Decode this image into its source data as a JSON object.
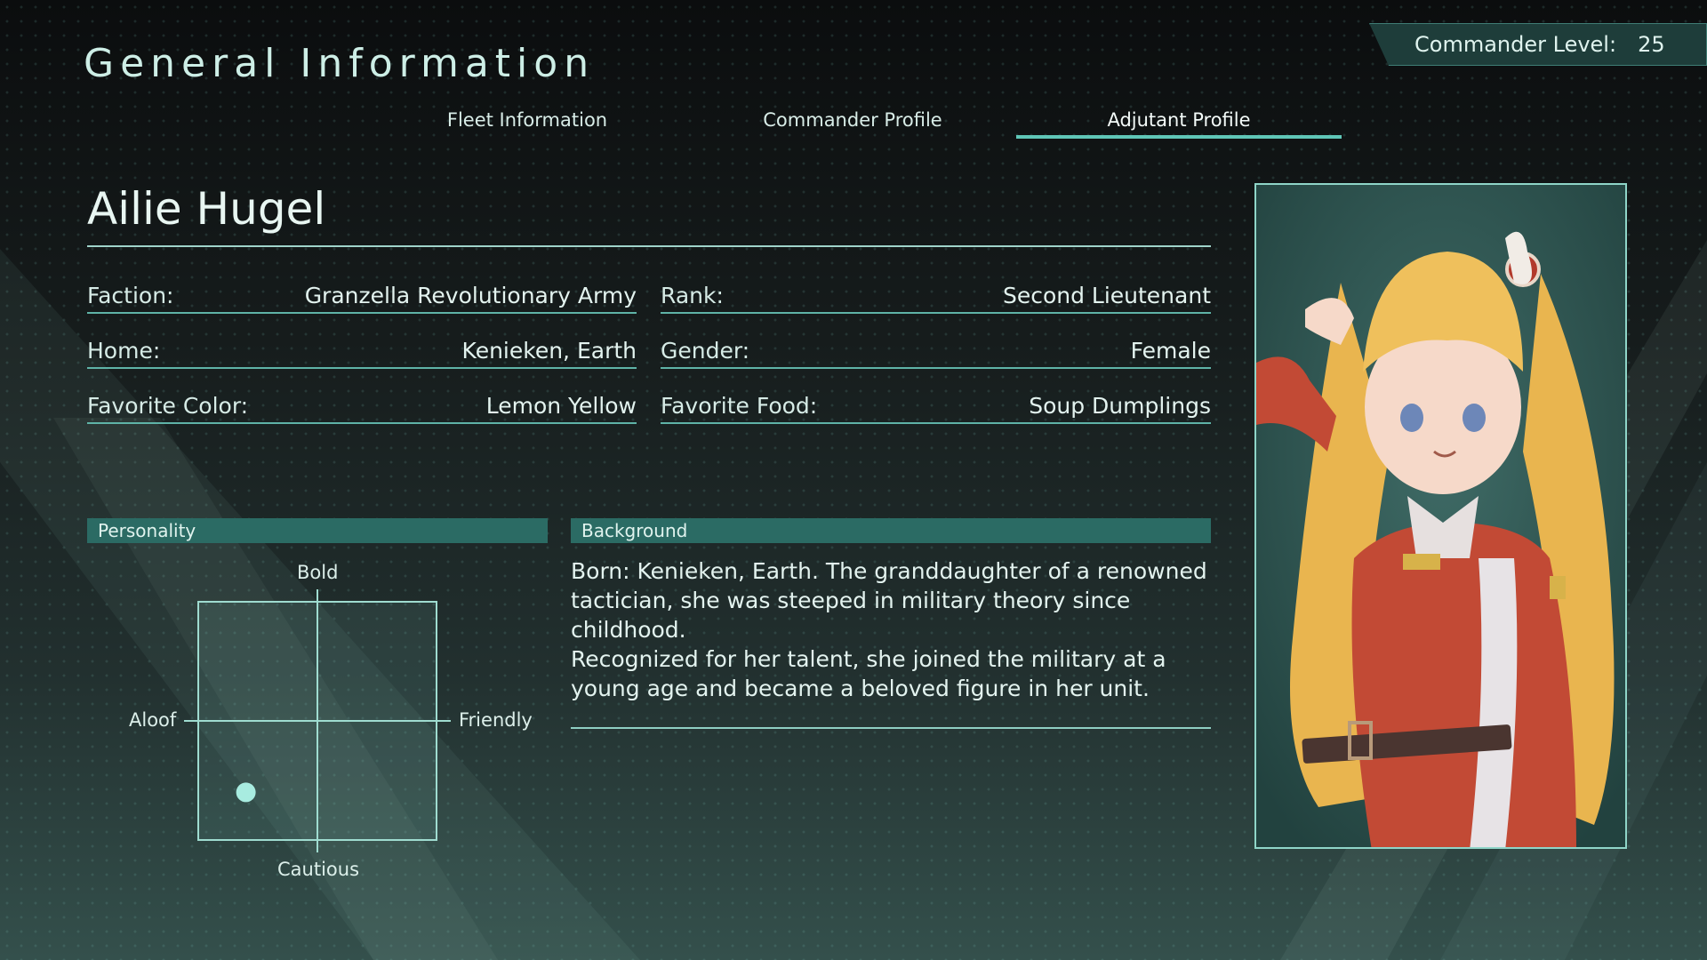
{
  "header": {
    "title": "General Information",
    "commander_level_label": "Commander Level:",
    "commander_level_value": "25"
  },
  "tabs": [
    {
      "label": "Fleet Information",
      "active": false
    },
    {
      "label": "Commander Profile",
      "active": false
    },
    {
      "label": "Adjutant Profile",
      "active": true
    }
  ],
  "profile": {
    "name": "Ailie Hugel",
    "fields": {
      "faction": {
        "label": "Faction:",
        "value": "Granzella Revolutionary Army"
      },
      "rank": {
        "label": "Rank:",
        "value": "Second Lieutenant"
      },
      "home": {
        "label": "Home:",
        "value": "Kenieken, Earth"
      },
      "gender": {
        "label": "Gender:",
        "value": "Female"
      },
      "favorite_color": {
        "label": "Favorite Color:",
        "value": "Lemon Yellow"
      },
      "favorite_food": {
        "label": "Favorite Food:",
        "value": "Soup Dumplings"
      }
    }
  },
  "personality": {
    "heading": "Personality",
    "axis_top": "Bold",
    "axis_bottom": "Cautious",
    "axis_left": "Aloof",
    "axis_right": "Friendly",
    "marker": {
      "friendly": -0.6,
      "bold": -0.6
    }
  },
  "background": {
    "heading": "Background",
    "text1": "Born: Kenieken, Earth. The granddaughter of a renowned tactician, she was steeped in military theory since childhood.",
    "text2": "Recognized for her talent, she joined the military at a young age and became a beloved figure in her unit."
  },
  "colors": {
    "accent": "#5fc6b7",
    "panel_header": "#2b6b64",
    "marker": "#a8ece0"
  }
}
